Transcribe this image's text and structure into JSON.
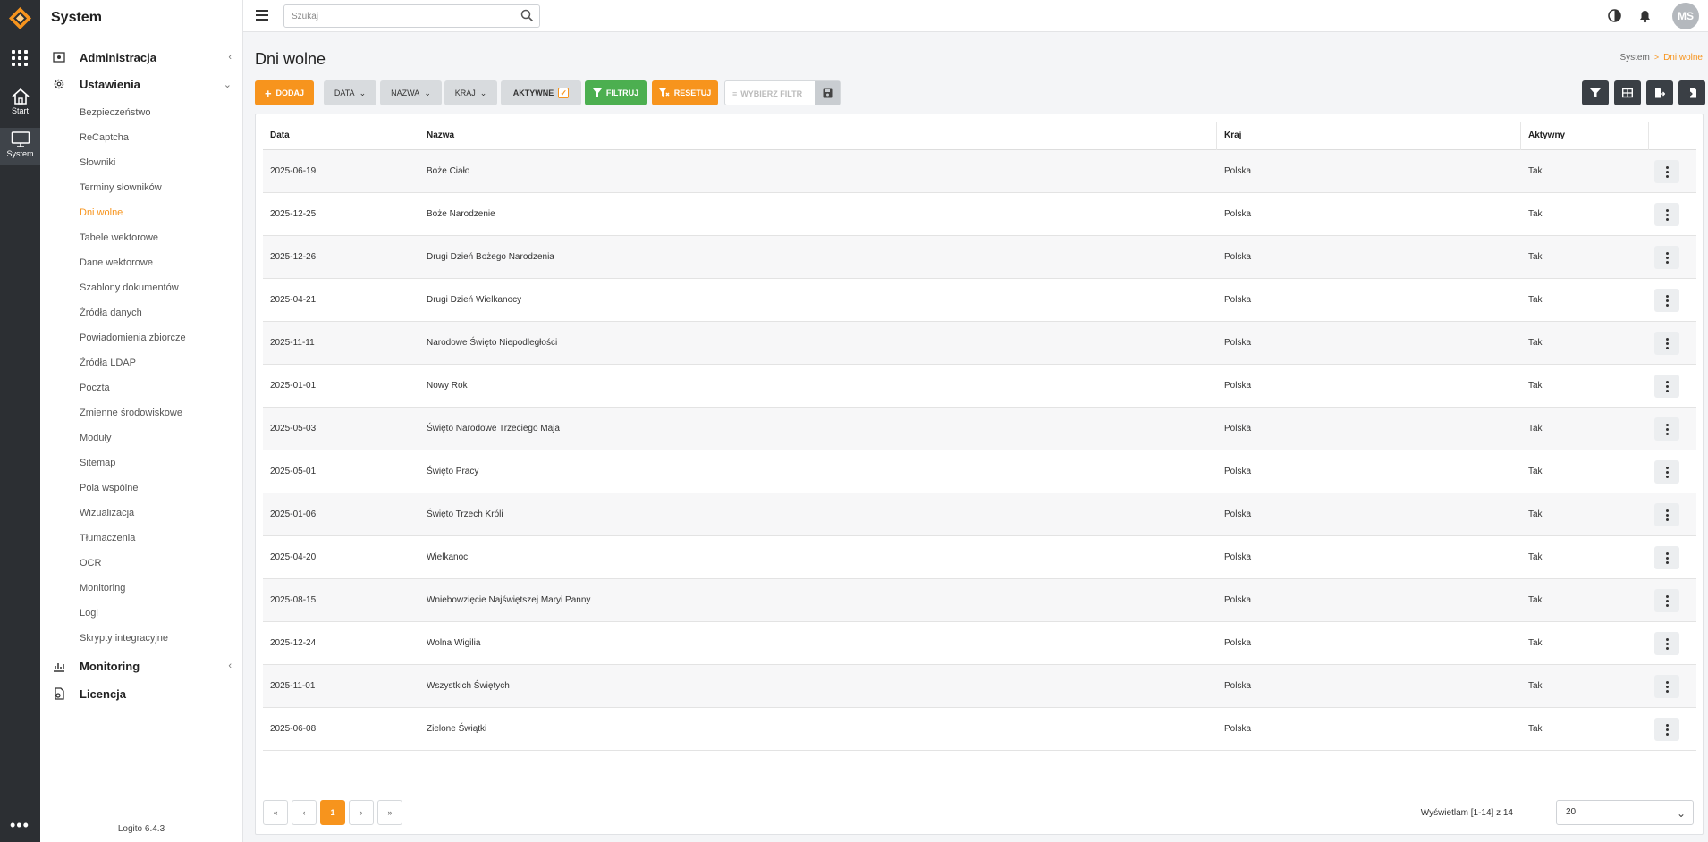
{
  "rail": {
    "items": [
      {
        "label": "Start",
        "icon": "home-icon"
      },
      {
        "label": "System",
        "icon": "monitor-icon"
      }
    ],
    "more": "•••"
  },
  "sidebar": {
    "title": "System",
    "sections": {
      "administracja": "Administracja",
      "ustawienia": "Ustawienia",
      "monitoring": "Monitoring",
      "licencja": "Licencja"
    },
    "links": [
      "Bezpieczeństwo",
      "ReCaptcha",
      "Słowniki",
      "Terminy słowników",
      "Dni wolne",
      "Tabele wektorowe",
      "Dane wektorowe",
      "Szablony dokumentów",
      "Źródła danych",
      "Powiadomienia zbiorcze",
      "Źródła LDAP",
      "Poczta",
      "Zmienne środowiskowe",
      "Moduły",
      "Sitemap",
      "Pola wspólne",
      "Wizualizacja",
      "Tłumaczenia",
      "OCR",
      "Monitoring",
      "Logi",
      "Skrypty integracyjne"
    ],
    "active_link": "Dni wolne",
    "version": "Logito 6.4.3"
  },
  "topbar": {
    "search_placeholder": "Szukaj",
    "avatar": "MS"
  },
  "page": {
    "title": "Dni wolne",
    "breadcrumb": {
      "root": "System",
      "sep": ">",
      "current": "Dni wolne"
    }
  },
  "toolbar": {
    "add": "Dodaj",
    "filters": {
      "data": "DATA",
      "nazwa": "NAZWA",
      "kraj": "KRAJ",
      "aktywne": "AKTYWNE"
    },
    "filter": "Filtruj",
    "reset": "Resetuj",
    "preset_placeholder": "WYBIERZ FILTR"
  },
  "table": {
    "columns": [
      "Data",
      "Nazwa",
      "Kraj",
      "Aktywny"
    ],
    "rows": [
      [
        "2025-06-19",
        "Boże Ciało",
        "Polska",
        "Tak"
      ],
      [
        "2025-12-25",
        "Boże Narodzenie",
        "Polska",
        "Tak"
      ],
      [
        "2025-12-26",
        "Drugi Dzień Bożego Narodzenia",
        "Polska",
        "Tak"
      ],
      [
        "2025-04-21",
        "Drugi Dzień Wielkanocy",
        "Polska",
        "Tak"
      ],
      [
        "2025-11-11",
        "Narodowe Święto Niepodległości",
        "Polska",
        "Tak"
      ],
      [
        "2025-01-01",
        "Nowy Rok",
        "Polska",
        "Tak"
      ],
      [
        "2025-05-03",
        "Święto Narodowe Trzeciego Maja",
        "Polska",
        "Tak"
      ],
      [
        "2025-05-01",
        "Święto Pracy",
        "Polska",
        "Tak"
      ],
      [
        "2025-01-06",
        "Święto Trzech Króli",
        "Polska",
        "Tak"
      ],
      [
        "2025-04-20",
        "Wielkanoc",
        "Polska",
        "Tak"
      ],
      [
        "2025-08-15",
        "Wniebowzięcie Najświętszej Maryi Panny",
        "Polska",
        "Tak"
      ],
      [
        "2025-12-24",
        "Wolna Wigilia",
        "Polska",
        "Tak"
      ],
      [
        "2025-11-01",
        "Wszystkich Świętych",
        "Polska",
        "Tak"
      ],
      [
        "2025-06-08",
        "Zielone Świątki",
        "Polska",
        "Tak"
      ]
    ]
  },
  "footer": {
    "current_page": "1",
    "showing": "Wyświetlam [1-14] z 14",
    "page_size": "20"
  },
  "colors": {
    "accent": "#f7941d",
    "filter_green": "#4caf50",
    "rail": "#2c2f33"
  }
}
